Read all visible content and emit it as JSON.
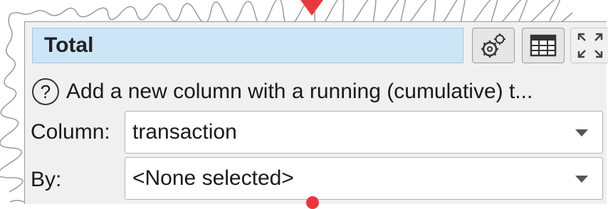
{
  "panel": {
    "title": "Total",
    "toolbar": {
      "options_icon": "gear-icon",
      "table_icon": "table-icon",
      "maximize_icon": "maximize-icon"
    },
    "description": "Add a new column with a running (cumulative) t...",
    "fields": [
      {
        "label": "Column:",
        "value": "transaction"
      },
      {
        "label": "By:",
        "value": "<None selected>"
      }
    ]
  },
  "colors": {
    "title_bg": "#cde6f7",
    "panel_bg": "#f0f0f0",
    "pointer": "#e8383d"
  }
}
